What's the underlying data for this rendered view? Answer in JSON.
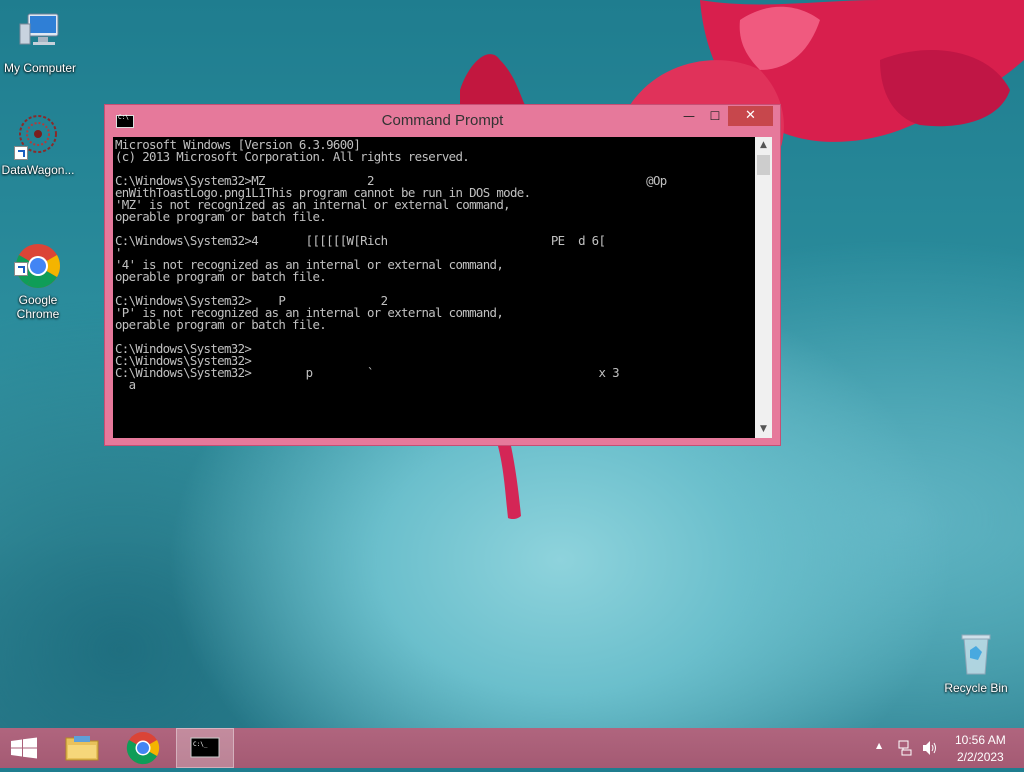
{
  "desktop": {
    "icons": [
      {
        "label": "My Computer",
        "icon": "monitor-icon"
      },
      {
        "label": "DataWagon...",
        "icon": "molecule-icon"
      },
      {
        "label": "Google\nChrome",
        "icon": "chrome-icon"
      },
      {
        "label": "Recycle Bin",
        "icon": "recycle-bin-icon"
      }
    ]
  },
  "window": {
    "title": "Command Prompt",
    "controls": {
      "minimize": "—",
      "maximize": "☐",
      "close": "✕"
    },
    "console_lines": [
      "Microsoft Windows [Version 6.3.9600]",
      "(c) 2013 Microsoft Corporation. All rights reserved.",
      "",
      "C:\\Windows\\System32>MZ               2                                        @Op",
      "enWithToastLogo.png1L1This program cannot be run in DOS mode.",
      "'MZ' is not recognized as an internal or external command,",
      "operable program or batch file.",
      "",
      "C:\\Windows\\System32>4       [[[[[[W[Rich                        PE  d 6[",
      "'",
      "'4' is not recognized as an internal or external command,",
      "operable program or batch file.",
      "",
      "C:\\Windows\\System32>    P              2",
      "'P' is not recognized as an internal or external command,",
      "operable program or batch file.",
      "",
      "C:\\Windows\\System32>",
      "C:\\Windows\\System32>",
      "C:\\Windows\\System32>        p        `                                 x 3",
      "  a"
    ],
    "scroll": {
      "up": "▲",
      "down": "▼"
    }
  },
  "taskbar": {
    "start_icon": "windows-logo-icon",
    "items": [
      {
        "name": "file-explorer",
        "icon": "folder-icon"
      },
      {
        "name": "chrome",
        "icon": "chrome-icon"
      },
      {
        "name": "command-prompt",
        "icon": "cmd-icon",
        "active": true
      }
    ],
    "tray": {
      "show_hidden": "▲",
      "network_icon": "network-icon",
      "volume_icon": "speaker-icon",
      "time": "10:56 AM",
      "date": "2/2/2023"
    }
  }
}
